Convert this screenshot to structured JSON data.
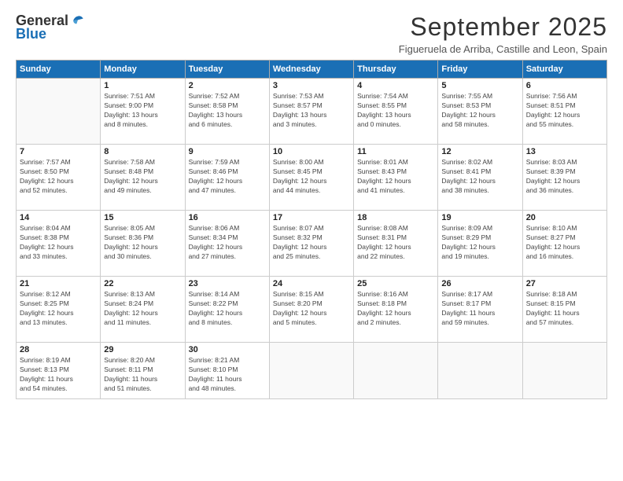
{
  "logo": {
    "general": "General",
    "blue": "Blue"
  },
  "title": "September 2025",
  "subtitle": "Figueruela de Arriba, Castille and Leon, Spain",
  "headers": [
    "Sunday",
    "Monday",
    "Tuesday",
    "Wednesday",
    "Thursday",
    "Friday",
    "Saturday"
  ],
  "weeks": [
    [
      {
        "day": "",
        "info": ""
      },
      {
        "day": "1",
        "info": "Sunrise: 7:51 AM\nSunset: 9:00 PM\nDaylight: 13 hours\nand 8 minutes."
      },
      {
        "day": "2",
        "info": "Sunrise: 7:52 AM\nSunset: 8:58 PM\nDaylight: 13 hours\nand 6 minutes."
      },
      {
        "day": "3",
        "info": "Sunrise: 7:53 AM\nSunset: 8:57 PM\nDaylight: 13 hours\nand 3 minutes."
      },
      {
        "day": "4",
        "info": "Sunrise: 7:54 AM\nSunset: 8:55 PM\nDaylight: 13 hours\nand 0 minutes."
      },
      {
        "day": "5",
        "info": "Sunrise: 7:55 AM\nSunset: 8:53 PM\nDaylight: 12 hours\nand 58 minutes."
      },
      {
        "day": "6",
        "info": "Sunrise: 7:56 AM\nSunset: 8:51 PM\nDaylight: 12 hours\nand 55 minutes."
      }
    ],
    [
      {
        "day": "7",
        "info": "Sunrise: 7:57 AM\nSunset: 8:50 PM\nDaylight: 12 hours\nand 52 minutes."
      },
      {
        "day": "8",
        "info": "Sunrise: 7:58 AM\nSunset: 8:48 PM\nDaylight: 12 hours\nand 49 minutes."
      },
      {
        "day": "9",
        "info": "Sunrise: 7:59 AM\nSunset: 8:46 PM\nDaylight: 12 hours\nand 47 minutes."
      },
      {
        "day": "10",
        "info": "Sunrise: 8:00 AM\nSunset: 8:45 PM\nDaylight: 12 hours\nand 44 minutes."
      },
      {
        "day": "11",
        "info": "Sunrise: 8:01 AM\nSunset: 8:43 PM\nDaylight: 12 hours\nand 41 minutes."
      },
      {
        "day": "12",
        "info": "Sunrise: 8:02 AM\nSunset: 8:41 PM\nDaylight: 12 hours\nand 38 minutes."
      },
      {
        "day": "13",
        "info": "Sunrise: 8:03 AM\nSunset: 8:39 PM\nDaylight: 12 hours\nand 36 minutes."
      }
    ],
    [
      {
        "day": "14",
        "info": "Sunrise: 8:04 AM\nSunset: 8:38 PM\nDaylight: 12 hours\nand 33 minutes."
      },
      {
        "day": "15",
        "info": "Sunrise: 8:05 AM\nSunset: 8:36 PM\nDaylight: 12 hours\nand 30 minutes."
      },
      {
        "day": "16",
        "info": "Sunrise: 8:06 AM\nSunset: 8:34 PM\nDaylight: 12 hours\nand 27 minutes."
      },
      {
        "day": "17",
        "info": "Sunrise: 8:07 AM\nSunset: 8:32 PM\nDaylight: 12 hours\nand 25 minutes."
      },
      {
        "day": "18",
        "info": "Sunrise: 8:08 AM\nSunset: 8:31 PM\nDaylight: 12 hours\nand 22 minutes."
      },
      {
        "day": "19",
        "info": "Sunrise: 8:09 AM\nSunset: 8:29 PM\nDaylight: 12 hours\nand 19 minutes."
      },
      {
        "day": "20",
        "info": "Sunrise: 8:10 AM\nSunset: 8:27 PM\nDaylight: 12 hours\nand 16 minutes."
      }
    ],
    [
      {
        "day": "21",
        "info": "Sunrise: 8:12 AM\nSunset: 8:25 PM\nDaylight: 12 hours\nand 13 minutes."
      },
      {
        "day": "22",
        "info": "Sunrise: 8:13 AM\nSunset: 8:24 PM\nDaylight: 12 hours\nand 11 minutes."
      },
      {
        "day": "23",
        "info": "Sunrise: 8:14 AM\nSunset: 8:22 PM\nDaylight: 12 hours\nand 8 minutes."
      },
      {
        "day": "24",
        "info": "Sunrise: 8:15 AM\nSunset: 8:20 PM\nDaylight: 12 hours\nand 5 minutes."
      },
      {
        "day": "25",
        "info": "Sunrise: 8:16 AM\nSunset: 8:18 PM\nDaylight: 12 hours\nand 2 minutes."
      },
      {
        "day": "26",
        "info": "Sunrise: 8:17 AM\nSunset: 8:17 PM\nDaylight: 11 hours\nand 59 minutes."
      },
      {
        "day": "27",
        "info": "Sunrise: 8:18 AM\nSunset: 8:15 PM\nDaylight: 11 hours\nand 57 minutes."
      }
    ],
    [
      {
        "day": "28",
        "info": "Sunrise: 8:19 AM\nSunset: 8:13 PM\nDaylight: 11 hours\nand 54 minutes."
      },
      {
        "day": "29",
        "info": "Sunrise: 8:20 AM\nSunset: 8:11 PM\nDaylight: 11 hours\nand 51 minutes."
      },
      {
        "day": "30",
        "info": "Sunrise: 8:21 AM\nSunset: 8:10 PM\nDaylight: 11 hours\nand 48 minutes."
      },
      {
        "day": "",
        "info": ""
      },
      {
        "day": "",
        "info": ""
      },
      {
        "day": "",
        "info": ""
      },
      {
        "day": "",
        "info": ""
      }
    ]
  ]
}
